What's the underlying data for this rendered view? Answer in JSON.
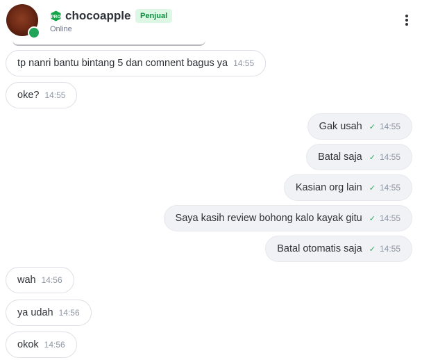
{
  "header": {
    "shop_name": "chocoapple",
    "role_badge": "Penjual",
    "status": "Online",
    "pro_icon": "pro-badge-icon",
    "menu_icon": "more-vertical-icon"
  },
  "messages": [
    {
      "direction": "in",
      "text": "tp nanri bantu bintang 5 dan comnent bagus ya",
      "time": "14:55"
    },
    {
      "direction": "in",
      "text": "oke?",
      "time": "14:55"
    },
    {
      "direction": "out",
      "text": "Gak usah",
      "time": "14:55",
      "read_icon": "check-icon"
    },
    {
      "direction": "out",
      "text": "Batal saja",
      "time": "14:55",
      "read_icon": "check-icon"
    },
    {
      "direction": "out",
      "text": "Kasian org lain",
      "time": "14:55",
      "read_icon": "check-icon"
    },
    {
      "direction": "out",
      "text": "Saya kasih review bohong kalo kayak gitu",
      "time": "14:55",
      "read_icon": "check-icon"
    },
    {
      "direction": "out",
      "text": "Batal otomatis saja",
      "time": "14:55",
      "read_icon": "check-icon"
    },
    {
      "direction": "in",
      "text": "wah",
      "time": "14:56"
    },
    {
      "direction": "in",
      "text": "ya udah",
      "time": "14:56"
    },
    {
      "direction": "in",
      "text": "okok",
      "time": "14:56"
    }
  ],
  "colors": {
    "online_dot": "#22a55a",
    "badge_bg": "#dcf8e4",
    "badge_text": "#0b8a3e",
    "check": "#2aa65c"
  }
}
